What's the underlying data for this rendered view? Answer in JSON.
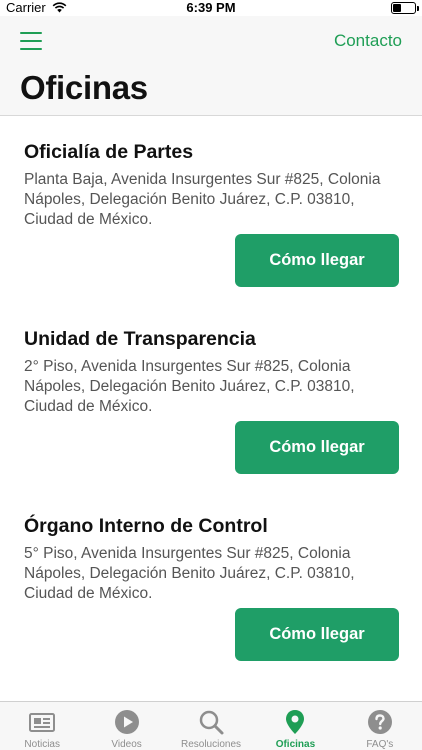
{
  "status": {
    "carrier": "Carrier",
    "time": "6:39 PM"
  },
  "header": {
    "contact_label": "Contacto",
    "title": "Oficinas"
  },
  "offices": [
    {
      "name": "Oficialía de Partes",
      "address": "Planta Baja, Avenida Insurgentes Sur #825, Colonia Nápoles, Delegación Benito Juárez, C.P. 03810, Ciudad de México.",
      "button": "Cómo llegar"
    },
    {
      "name": "Unidad de Transparencia",
      "address": "2° Piso, Avenida Insurgentes Sur #825, Colonia Nápoles, Delegación Benito Juárez, C.P. 03810, Ciudad de México.",
      "button": "Cómo llegar"
    },
    {
      "name": "Órgano Interno de Control",
      "address": "5° Piso, Avenida Insurgentes Sur #825, Colonia Nápoles, Delegación Benito Juárez, C.P. 03810, Ciudad de México.",
      "button": "Cómo llegar"
    }
  ],
  "tabs": [
    {
      "label": "Noticias",
      "icon": "newspaper-icon",
      "active": false
    },
    {
      "label": "Videos",
      "icon": "play-icon",
      "active": false
    },
    {
      "label": "Resoluciones",
      "icon": "search-icon",
      "active": false
    },
    {
      "label": "Oficinas",
      "icon": "location-pin-icon",
      "active": true
    },
    {
      "label": "FAQ's",
      "icon": "question-icon",
      "active": false
    }
  ],
  "colors": {
    "accent": "#1f9e55",
    "button": "#1f9e67",
    "inactive": "#8e8e8e"
  }
}
